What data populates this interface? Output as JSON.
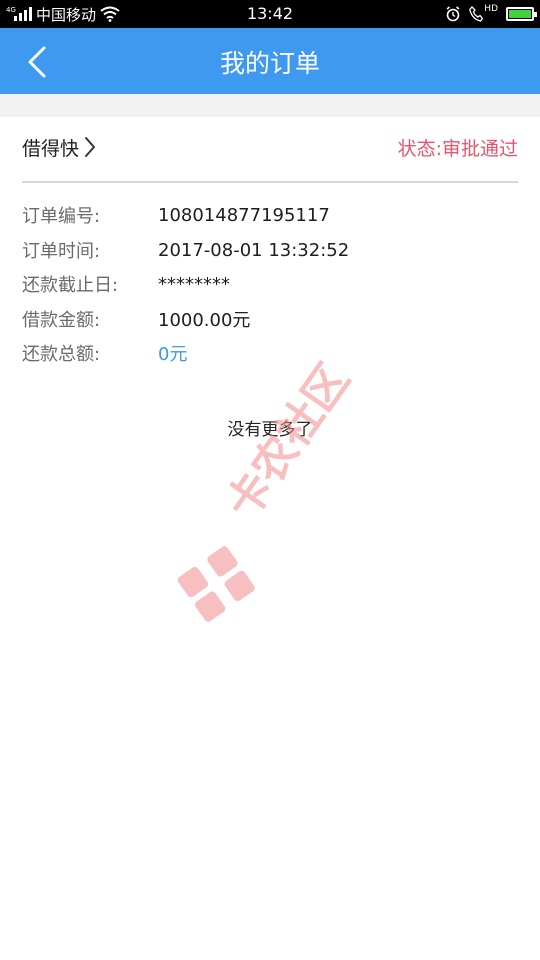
{
  "status_bar": {
    "network": "4G",
    "carrier": "中国移动",
    "time": "13:42",
    "hd_label": "HD"
  },
  "header": {
    "title": "我的订单"
  },
  "order": {
    "product_name": "借得快",
    "status": "状态:审批通过",
    "fields": [
      {
        "label": "订单编号:",
        "value": "108014877195117"
      },
      {
        "label": "订单时间:",
        "value": "2017-08-01 13:32:52"
      },
      {
        "label": "还款截止日:",
        "value": "********"
      },
      {
        "label": "借款金额:",
        "value": "1000.00元"
      },
      {
        "label": "还款总额:",
        "value": "0元"
      }
    ]
  },
  "footer_text": "没有更多了",
  "watermark_text": "卡农社区",
  "colors": {
    "header_bg": "#3d9af0",
    "status_text": "#e8546a",
    "total_value": "#3b9ae0",
    "watermark": "#f28b8b"
  }
}
